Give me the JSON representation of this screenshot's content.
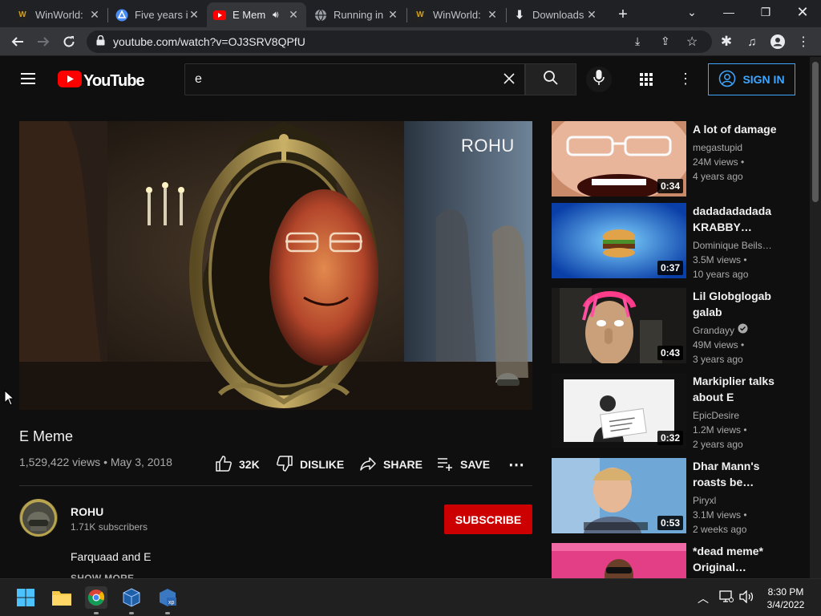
{
  "browser": {
    "tabs": [
      {
        "title": "WinWorld:",
        "favicon": "winworld-icon",
        "active": false
      },
      {
        "title": "Five years i",
        "favicon": "drive-icon",
        "active": false
      },
      {
        "title": "E Mem",
        "favicon": "youtube-icon",
        "active": true,
        "audio": true
      },
      {
        "title": "Running in",
        "favicon": "globe-icon",
        "active": false
      },
      {
        "title": "WinWorld:",
        "favicon": "winworld-icon",
        "active": false
      },
      {
        "title": "Downloads",
        "favicon": "download-icon",
        "active": false
      }
    ],
    "url": "youtube.com/watch?v=OJ3SRV8QPfU"
  },
  "youtube": {
    "logo_text": "YouTube",
    "search_value": "e",
    "signin_label": "SIGN IN",
    "player_watermark": "ROHU",
    "video": {
      "title": "E Meme",
      "meta": "1,529,422 views • May 3, 2018",
      "likes": "32K",
      "dislike_label": "DISLIKE",
      "share_label": "SHARE",
      "save_label": "SAVE"
    },
    "channel": {
      "name": "ROHU",
      "subscribers": "1.71K subscribers",
      "subscribe_label": "SUBSCRIBE",
      "description": "Farquaad and E",
      "show_more": "SHOW MORE"
    },
    "recommendations": [
      {
        "title": "A lot of damage",
        "channel": "megastupid",
        "views": "24M views •",
        "age": "4 years ago",
        "duration": "0:34",
        "verified": false
      },
      {
        "title": "dadadadadada KRABBY…",
        "channel": "Dominique Beils…",
        "views": "3.5M views •",
        "age": "10 years ago",
        "duration": "0:37",
        "verified": false
      },
      {
        "title": "Lil Globglogabgalab",
        "channel": "Grandayy",
        "views": "49M views •",
        "age": "3 years ago",
        "duration": "0:43",
        "verified": true
      },
      {
        "title": "Markiplier talks about E",
        "channel": "EpicDesire",
        "views": "1.2M views •",
        "age": "2 years ago",
        "duration": "0:32",
        "verified": false
      },
      {
        "title": "Dhar Mann's roasts be…",
        "channel": "Piryxl",
        "views": "3.1M views •",
        "age": "2 weeks ago",
        "duration": "0:53",
        "verified": false
      },
      {
        "title": "*dead meme* Original…",
        "channel": "",
        "views": "",
        "age": "",
        "duration": "",
        "verified": false
      }
    ]
  },
  "taskbar": {
    "time": "8:30 PM",
    "date": "3/4/2022"
  }
}
